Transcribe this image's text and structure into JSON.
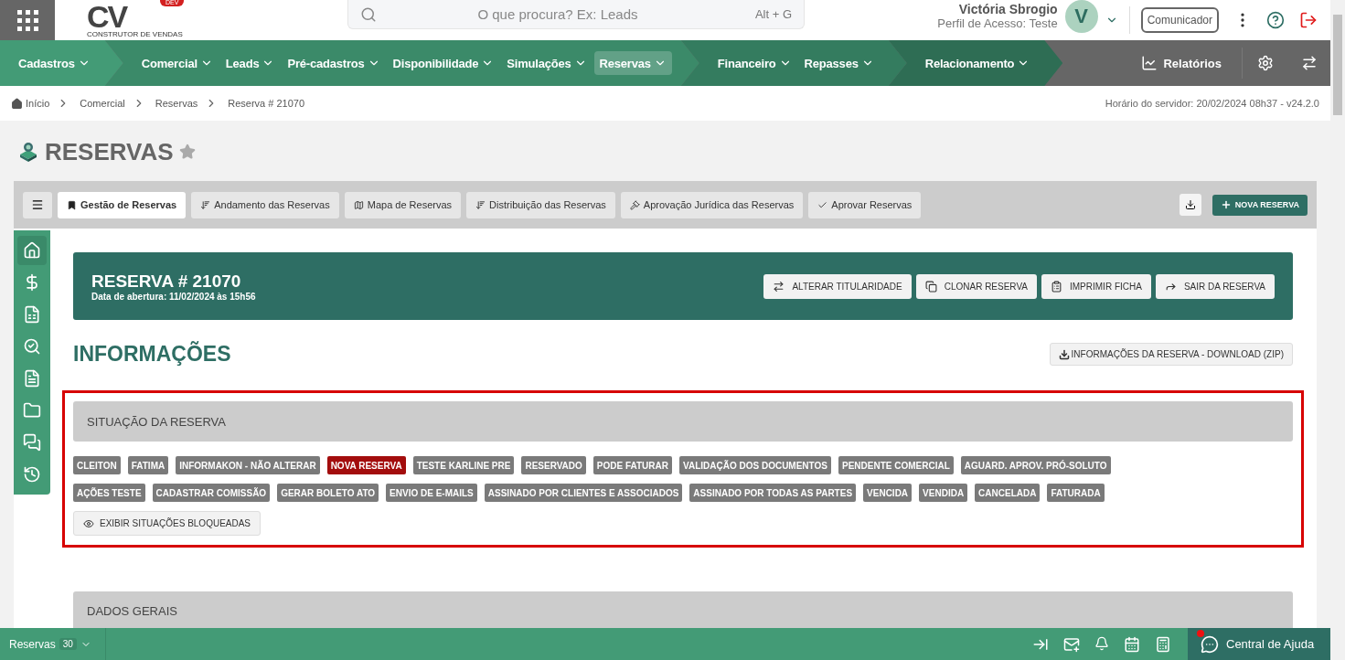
{
  "header": {
    "logo": {
      "mark": "CV",
      "badge": "DEV",
      "tagline": "CONSTRUTOR DE VENDAS"
    },
    "search": {
      "placeholder": "O que procura? Ex: Leads",
      "shortcut": "Alt + G"
    },
    "user": {
      "name": "Victória Sbrogio",
      "profile": "Perfil de Acesso: Teste",
      "initial": "V"
    },
    "communicator": "Comunicador"
  },
  "nav": {
    "groups": [
      {
        "color": "#439b76",
        "items": [
          {
            "label": "Cadastros",
            "selected": false
          }
        ]
      },
      {
        "color": "#3b8a69",
        "items": [
          {
            "label": "Comercial",
            "selected": false
          },
          {
            "label": "Leads",
            "selected": false
          },
          {
            "label": "Pré-cadastros",
            "selected": false
          },
          {
            "label": "Disponibilidade",
            "selected": false
          },
          {
            "label": "Simulações",
            "selected": false
          },
          {
            "label": "Reservas",
            "selected": true
          }
        ]
      },
      {
        "color": "#347c5f",
        "items": [
          {
            "label": "Financeiro",
            "selected": false
          },
          {
            "label": "Repasses",
            "selected": false
          }
        ]
      },
      {
        "color": "#2e6d54",
        "items": [
          {
            "label": "Relacionamento",
            "selected": false
          }
        ]
      }
    ],
    "reports": "Relatórios"
  },
  "breadcrumb": [
    "Início",
    "Comercial",
    "Reservas",
    "Reserva # 21070"
  ],
  "server_time": "Horário do servidor: 20/02/2024 08h37 - v24.2.0",
  "page_title": "RESERVAS",
  "tabs": [
    {
      "label": "Gestão de Reservas",
      "selected": true
    },
    {
      "label": "Andamento das Reservas",
      "selected": false
    },
    {
      "label": "Mapa de Reservas",
      "selected": false
    },
    {
      "label": "Distribuição das Reservas",
      "selected": false
    },
    {
      "label": "Aprovação Jurídica das Reservas",
      "selected": false
    },
    {
      "label": "Aprovar Reservas",
      "selected": false
    }
  ],
  "new_button": "NOVA RESERVA",
  "side_menu": [
    {
      "selected": true
    },
    {
      "selected": false
    },
    {
      "selected": false
    },
    {
      "selected": false
    },
    {
      "selected": false
    },
    {
      "selected": false
    },
    {
      "selected": false
    },
    {
      "selected": false
    }
  ],
  "reservation": {
    "title": "RESERVA # 21070",
    "opened": "Data de abertura: 11/02/2024 às 15h56",
    "actions": [
      "ALTERAR TITULARIDADE",
      "CLONAR RESERVA",
      "IMPRIMIR FICHA",
      "SAIR DA RESERVA"
    ]
  },
  "info": {
    "title": "INFORMAÇÕES",
    "download": "INFORMAÇÕES DA RESERVA - DOWNLOAD (ZIP)"
  },
  "status_section": {
    "title": "SITUAÇÃO DA RESERVA",
    "statuses": [
      {
        "label": "CLEITON",
        "selected": false
      },
      {
        "label": "FATIMA",
        "selected": false
      },
      {
        "label": "INFORMAKON - NÃO ALTERAR",
        "selected": false
      },
      {
        "label": "NOVA RESERVA",
        "selected": true
      },
      {
        "label": "TESTE KARLINE PRE",
        "selected": false
      },
      {
        "label": "RESERVADO",
        "selected": false
      },
      {
        "label": "PODE FATURAR",
        "selected": false
      },
      {
        "label": "VALIDAÇÃO DOS DOCUMENTOS",
        "selected": false
      },
      {
        "label": "PENDENTE COMERCIAL",
        "selected": false
      },
      {
        "label": "AGUARD. APROV. PRÓ-SOLUTO",
        "selected": false
      },
      {
        "label": "AÇÕES TESTE",
        "selected": false
      },
      {
        "label": "CADASTRAR COMISSÃO",
        "selected": false
      },
      {
        "label": "GERAR BOLETO ATO",
        "selected": false
      },
      {
        "label": "ENVIO DE E-MAILS",
        "selected": false
      },
      {
        "label": "ASSINADO POR CLIENTES E ASSOCIADOS",
        "selected": false
      },
      {
        "label": "ASSINADO POR TODAS AS PARTES",
        "selected": false
      },
      {
        "label": "VENCIDA",
        "selected": false
      },
      {
        "label": "VENDIDA",
        "selected": false
      },
      {
        "label": "CANCELADA",
        "selected": false
      },
      {
        "label": "FATURADA",
        "selected": false
      }
    ],
    "show_blocked": "EXIBIR SITUAÇÕES BLOQUEADAS"
  },
  "general_section": {
    "title": "DADOS GERAIS"
  },
  "footer": {
    "module": "Reservas",
    "count": "30",
    "help": "Central de Ajuda"
  }
}
